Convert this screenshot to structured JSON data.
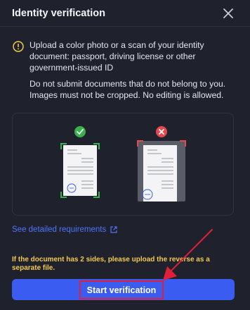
{
  "header": {
    "title": "Identity verification"
  },
  "instructions": {
    "primary": "Upload a color photo or a scan of your identity document: passport, driving license or other government-issued ID",
    "secondary": "Do not submit documents that do not belong to you. Images must not be cropped. No editing is allowed."
  },
  "examples": {
    "good": {
      "icon": "check-icon"
    },
    "bad": {
      "icon": "cross-icon"
    }
  },
  "links": {
    "requirements": "See detailed requirements"
  },
  "note": "If the document has 2 sides, please upload the reverse as a separate file.",
  "actions": {
    "start": "Start verification"
  },
  "colors": {
    "background": "#1f222d",
    "accent": "#3a5cf0",
    "link": "#4f73ff",
    "warning": "#f2c94c",
    "success": "#38b24a",
    "error": "#e5484d",
    "annotation": "#e0203a"
  }
}
